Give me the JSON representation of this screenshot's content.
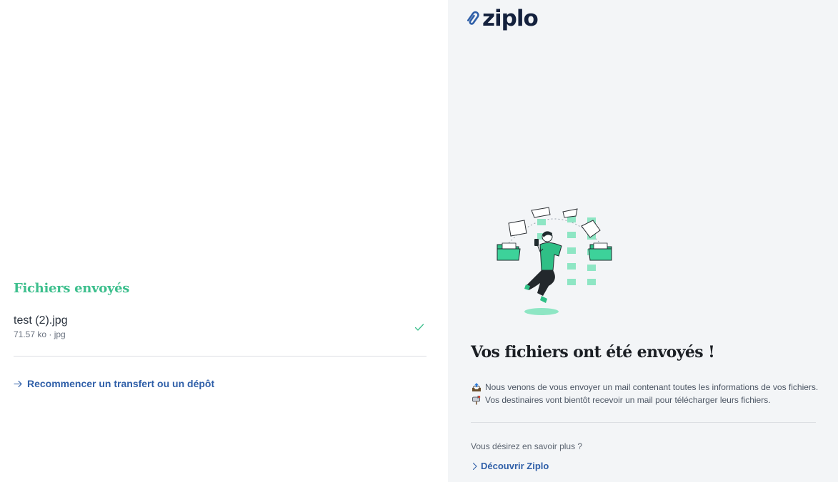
{
  "brand": {
    "name": "ziplo",
    "logo_icon": "paperclip-icon"
  },
  "left": {
    "section_title": "Fichiers envoyés",
    "files": [
      {
        "name": "test (2).jpg",
        "meta": "71.57 ko · jpg",
        "status_icon": "check-icon"
      }
    ],
    "restart_link": "Recommencer un transfert ou un dépôt"
  },
  "right": {
    "headline": "Vos fichiers ont été envoyés !",
    "info_lines": [
      {
        "icon": "outbox-tray-icon",
        "text": "Nous venons de vous envoyer un mail contenant toutes les informations de vos fichiers."
      },
      {
        "icon": "mailbox-icon",
        "text": "Vos destinaires vont bientôt recevoir un mail pour télécharger leurs fichiers."
      }
    ],
    "more_question": "Vous désirez en savoir plus ?",
    "discover_link": "Découvrir Ziplo"
  },
  "colors": {
    "accent_green": "#3dbf8d",
    "link_blue": "#2f5fa8",
    "right_bg": "#f3f5f7"
  }
}
